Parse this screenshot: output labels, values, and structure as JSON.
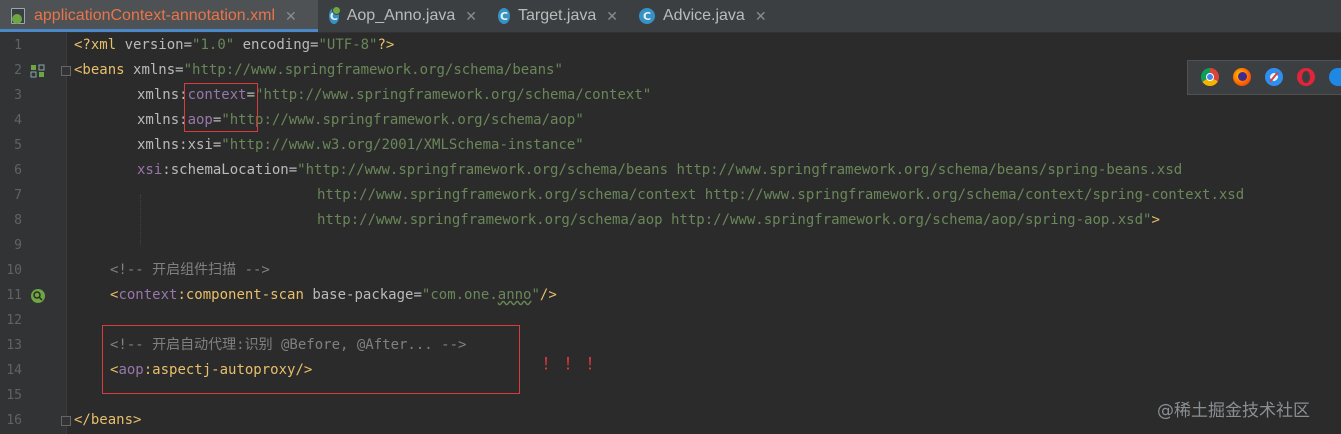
{
  "tabs": [
    {
      "label": "applicationContext-annotation.xml",
      "icon": "xml-file-icon",
      "active": true
    },
    {
      "label": "Aop_Anno.java",
      "icon": "class-icon",
      "active": false
    },
    {
      "label": "Target.java",
      "icon": "class-icon",
      "active": false
    },
    {
      "label": "Advice.java",
      "icon": "class-icon",
      "active": false
    }
  ],
  "close_glyph": "✕",
  "lines": {
    "n1": "1",
    "n2": "2",
    "n3": "3",
    "n4": "4",
    "n5": "5",
    "n6": "6",
    "n7": "7",
    "n8": "8",
    "n9": "9",
    "n10": "10",
    "n11": "11",
    "n12": "12",
    "n13": "13",
    "n14": "14",
    "n15": "15",
    "n16": "16"
  },
  "code": {
    "l1_open": "<?xml ",
    "l1_version_attr": "version",
    "l1_eq1": "=",
    "l1_version_val": "\"1.0\"",
    "l1_encoding_attr": " encoding",
    "l1_eq2": "=",
    "l1_encoding_val": "\"UTF-8\"",
    "l1_close": "?>",
    "l2_tag": "<beans ",
    "l2_attr": "xmlns",
    "l2_eq": "=",
    "l2_val": "\"http://www.springframework.org/schema/beans\"",
    "l3_attr": "xmlns:",
    "l3_ns": "context",
    "l3_eq": "=",
    "l3_val": "\"http://www.springframework.org/schema/context\"",
    "l4_attr": "xmlns:",
    "l4_ns": "aop",
    "l4_eq": "=",
    "l4_val": "\"http://www.springframework.org/schema/aop\"",
    "l5_attr": "xmlns:xsi",
    "l5_eq": "=",
    "l5_val": "\"http://www.w3.org/2001/XMLSchema-instance\"",
    "l6_ns": "xsi",
    "l6_attr": ":schemaLocation",
    "l6_eq": "=",
    "l6_val": "\"http://www.springframework.org/schema/beans http://www.springframework.org/schema/beans/spring-beans.xsd",
    "l7_val": "http://www.springframework.org/schema/context http://www.springframework.org/schema/context/spring-context.xsd",
    "l8_val": "http://www.springframework.org/schema/aop http://www.springframework.org/schema/aop/spring-aop.xsd\"",
    "l8_close": ">",
    "l10_comment": "<!-- 开启组件扫描 -->",
    "l11_lt": "<",
    "l11_ns": "context",
    "l11_tag": ":component-scan ",
    "l11_attr": "base-package",
    "l11_eq": "=",
    "l11_val_a": "\"com.one.",
    "l11_val_b": "anno",
    "l11_val_c": "\"",
    "l11_close": "/>",
    "l13_comment": "<!-- 开启自动代理:识别 @Before, @After... -->",
    "l14_lt": "<",
    "l14_ns": "aop",
    "l14_tag": ":aspectj-autoproxy/>",
    "l16_tag": "</beans>"
  },
  "annotation": {
    "exclamations": "！！！"
  },
  "browser_icons": [
    "chrome-icon",
    "firefox-icon",
    "safari-icon",
    "opera-icon",
    "ie-icon"
  ],
  "watermark": "@稀土掘金技术社区",
  "colors": {
    "background": "#2b2b2b",
    "tag": "#e8bf6a",
    "namespace": "#9876aa",
    "string": "#6a8759",
    "comment": "#808080",
    "highlight_box": "#d83b3b",
    "active_tab_text": "#e8754a"
  }
}
